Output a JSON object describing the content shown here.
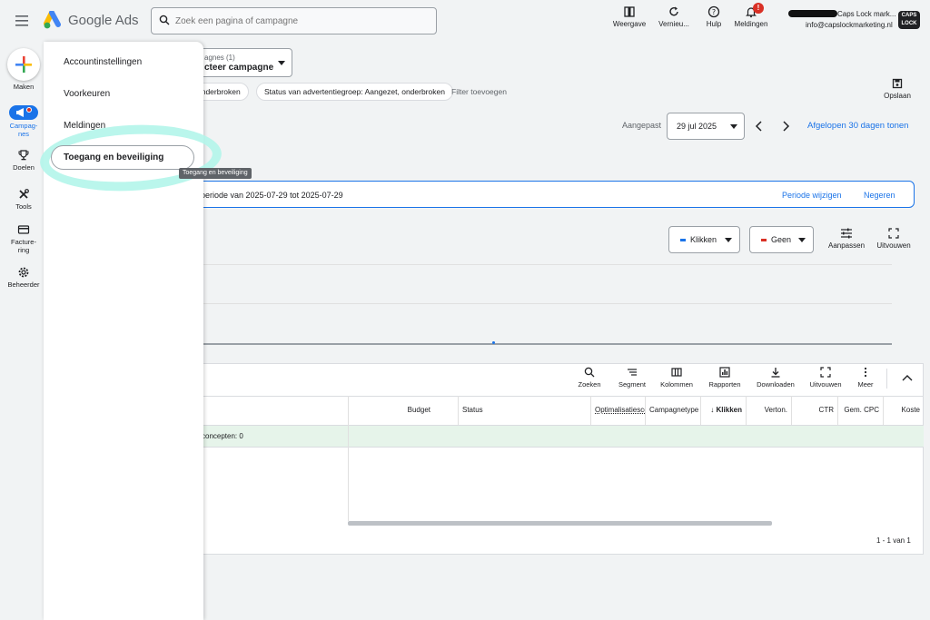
{
  "header": {
    "app_name": "Google Ads",
    "search_placeholder": "Zoek een pagina of campagne",
    "tools": [
      {
        "label": "Weergave",
        "icon": "view-icon"
      },
      {
        "label": "Vernieu...",
        "icon": "refresh-icon"
      },
      {
        "label": "Hulp",
        "icon": "help-icon"
      },
      {
        "label": "Meldingen",
        "icon": "bell-icon"
      }
    ],
    "notification_badge": "!",
    "account_name": "Caps Lock mark...",
    "account_email": "info@capslockmarketing.nl",
    "account_logo_text": "CAPS LOCK"
  },
  "rail": {
    "items": [
      {
        "label": "Maken",
        "icon": "plus-icon"
      },
      {
        "label": "Campag-\nnes",
        "icon": "campaigns-icon"
      },
      {
        "label": "Doelen",
        "icon": "trophy-icon"
      },
      {
        "label": "Tools",
        "icon": "tools-icon"
      },
      {
        "label": "Facture-\nring",
        "icon": "billing-icon"
      },
      {
        "label": "Beheerder",
        "icon": "gear-icon"
      }
    ]
  },
  "flyout": {
    "items": [
      "Accountinstellingen",
      "Voorkeuren",
      "Meldingen",
      "Toegang en beveiliging"
    ],
    "tooltip": "Toegang en beveiliging"
  },
  "main": {
    "campaign_select_caption": "agnes (1)",
    "campaign_select_value": "cteer campagne",
    "filters": [
      "onderbroken",
      "Status van advertentiegroep: Aangezet, onderbroken"
    ],
    "add_filter": "Filter toevoegen",
    "save_label": "Opslaan",
    "date_label": "Aangepast",
    "date_value": "29 jul 2025",
    "date_action": "Afgelopen 30 dagen tonen",
    "notice_text": "periode van 2025-07-29 tot 2025-07-29",
    "notice_change": "Periode wijzigen",
    "notice_ignore": "Negeren",
    "metric1": "Klikken",
    "metric2": "Geen",
    "metric1_color": "#1a73e8",
    "metric2_color": "#d93025",
    "chart_tools": [
      {
        "label": "Aanpassen",
        "icon": "tune-icon"
      },
      {
        "label": "Uitvouwen",
        "icon": "expand-icon"
      }
    ],
    "table_tools": [
      {
        "label": "Zoeken",
        "icon": "search-icon"
      },
      {
        "label": "Segment",
        "icon": "segment-icon"
      },
      {
        "label": "Kolommen",
        "icon": "columns-icon"
      },
      {
        "label": "Rapporten",
        "icon": "reports-icon"
      },
      {
        "label": "Downloaden",
        "icon": "download-icon"
      },
      {
        "label": "Uitvouwen",
        "icon": "expand-icon"
      },
      {
        "label": "Meer",
        "icon": "more-icon"
      }
    ],
    "columns": [
      "Budget",
      "Status",
      "Optimalisatiescore",
      "Campagnetype",
      "Klikken",
      "Verton.",
      "CTR",
      "Gem. CPC",
      "Koste"
    ],
    "row_text": "concepten: 0",
    "pagination": "1 - 1 van 1"
  }
}
